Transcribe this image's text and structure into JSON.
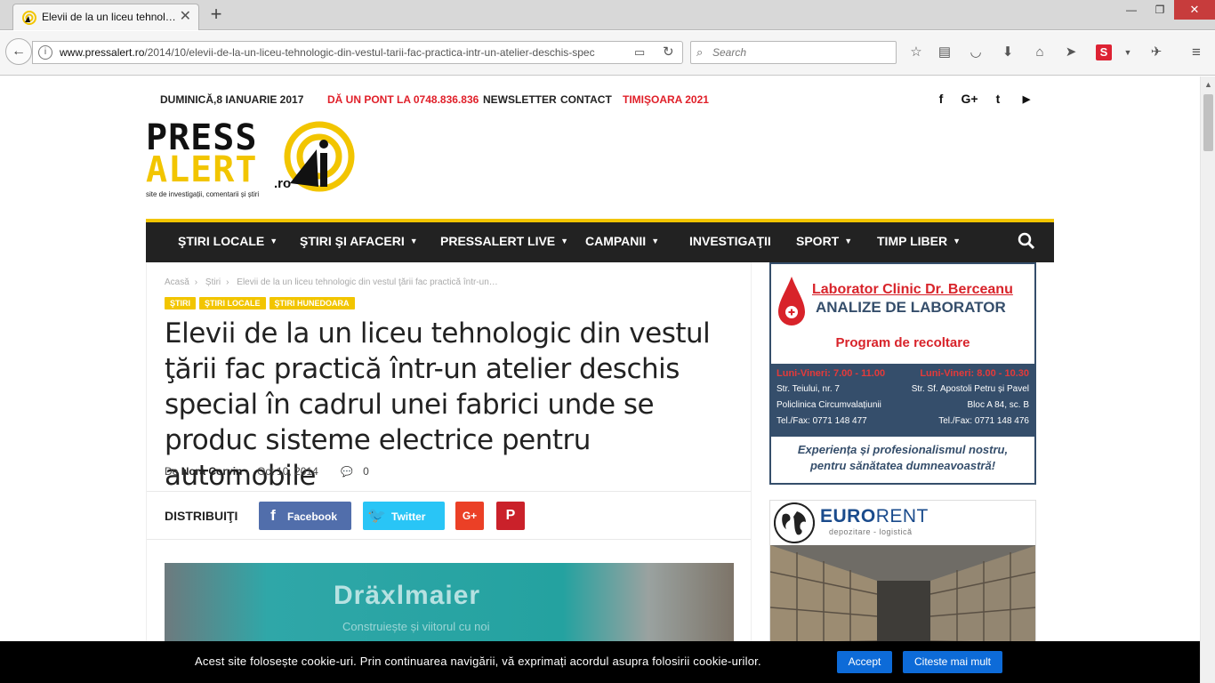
{
  "browser": {
    "tab_title": "Elevii de la un liceu tehnol…",
    "url_host": "www.pressalert.ro",
    "url_path": "/2014/10/elevii-de-la-un-liceu-tehnologic-din-vestul-tarii-fac-practica-intr-un-atelier-deschis-spec",
    "search_placeholder": "Search"
  },
  "topbar": {
    "date": "DUMINICĂ,8 IANUARIE 2017",
    "tip": "DĂ UN PONT LA 0748.836.836",
    "newsletter": "NEWSLETTER",
    "contact": "CONTACT",
    "timisoara": "TIMIŞOARA 2021",
    "social": [
      "f",
      "G+",
      "t",
      "▶"
    ]
  },
  "logo": {
    "line1": "PRESS",
    "line2": "ALERT",
    "suffix": ".ro",
    "tagline": "site de investigații, comentarii și știri"
  },
  "menu": {
    "items": [
      "ŞTIRI LOCALE",
      "ŞTIRI ŞI AFACERI",
      "PRESSALERT LIVE",
      "CAMPANII",
      "INVESTIGAŢII",
      "SPORT",
      "TIMP LIBER"
    ]
  },
  "article": {
    "breadcrumbs": [
      "Acasă",
      "Știri",
      "Elevii de la un liceu tehnologic din vestul ţării fac practică într-un…"
    ],
    "categories": [
      "ŞTIRI",
      "ŞTIRI LOCALE",
      "ŞTIRI HUNEDOARA"
    ],
    "title": "Elevii de la un liceu tehnologic din vestul ţării fac practică într-un atelier deschis special în cadrul unei fabrici unde se produc sisteme electrice pentru automobile",
    "by": "De",
    "author": "Nora Corvin",
    "date": "Oct 10, 2014",
    "comments": "0",
    "share_label": "DISTRIBUIŢI",
    "facebook": "Facebook",
    "twitter": "Twitter",
    "photo_brand": "Dräxlmaier",
    "photo_sub": "Construiește și viitorul cu noi"
  },
  "ad_lab": {
    "title": "Laborator Clinic Dr. Berceanu",
    "subtitle": "ANALIZE DE LABORATOR",
    "program": "Program de recoltare",
    "left_hours": "Luni-Vineri: 7.00 - 11.00",
    "left_lines": [
      "Str. Teiului, nr. 7",
      "Policlinica Circumvalațiunii",
      "Tel./Fax: 0771 148 477"
    ],
    "right_hours": "Luni-Vineri: 8.00 - 10.30",
    "right_lines": [
      "Str. Sf. Apostoli Petru și Pavel",
      "Bloc A 84, sc. B",
      "Tel./Fax: 0771 148 476"
    ],
    "footer1": "Experiența și profesionalismul nostru,",
    "footer2": "pentru sănătatea dumneavoastră!"
  },
  "ad_eurorent": {
    "brand_a": "EURO",
    "brand_b": "RENT",
    "tagline": "depozitare - logistică"
  },
  "cookie": {
    "text": "Acest site folosește cookie-uri. Prin continuarea navigării, vă exprimați acordul asupra folosirii cookie-urilor.",
    "accept": "Accept",
    "more": "Citeste mai mult"
  },
  "colors": {
    "accent_yellow": "#f2c500",
    "menu_bg": "#222222",
    "red": "#e0202a",
    "facebook": "#516eab",
    "twitter": "#29c5f6",
    "googleplus": "#eb4026",
    "pinterest": "#ca212a",
    "cookie_button": "#0d6bd8"
  }
}
